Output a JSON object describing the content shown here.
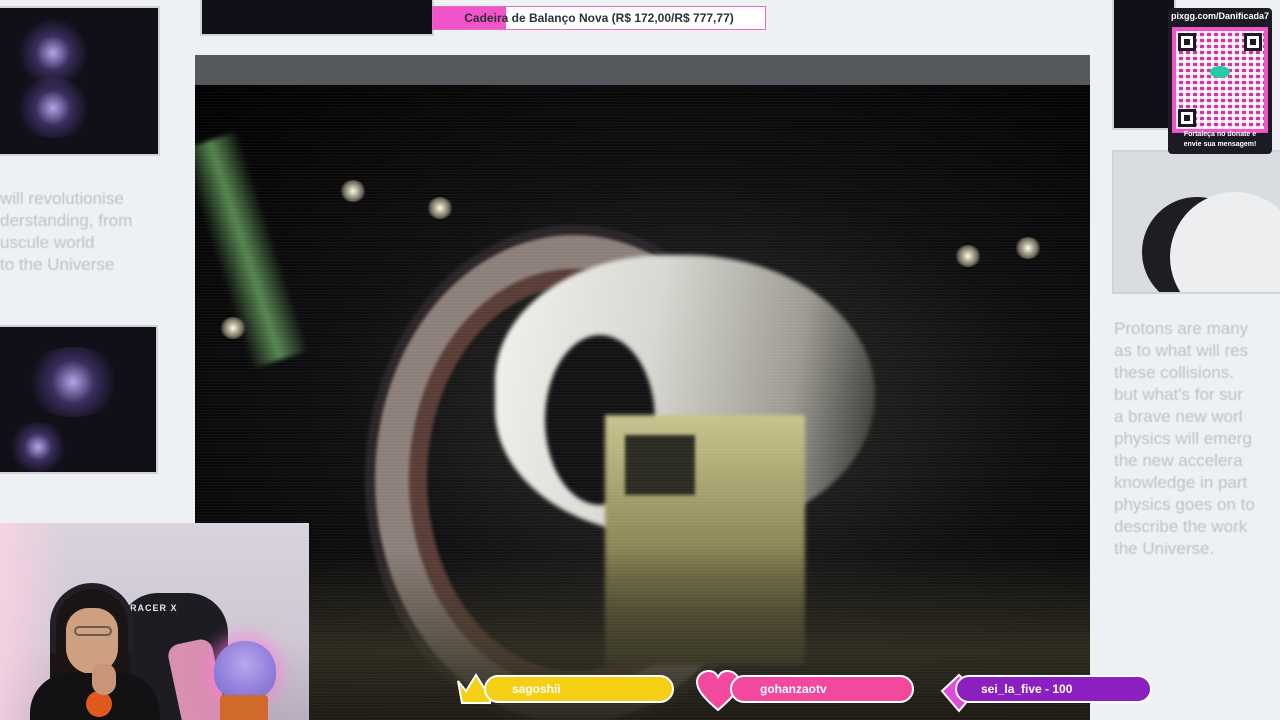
{
  "donation_goal": {
    "label": "Cadeira de Balanço Nova (R$ 172,00/R$ 777,77)",
    "progress_fraction": 0.221,
    "fill_color": "#f154c8"
  },
  "qr_widget": {
    "url": "pixgg.com/Danificada7",
    "caption": "Fortaleça no donate e\nenvie sua mensagem!",
    "accent_color": "#f154c8"
  },
  "background_text": {
    "left": "will revolutionise\nderstanding, from\nuscule world\nto the Universe",
    "right": "Protons are many\nas to what will res\nthese collisions.\nbut what's for sur\na brave new worl\nphysics will emerg\nthe new accelera\nknowledge in part\nphysics goes on to\ndescribe the work\nthe Universe."
  },
  "webcam": {
    "chair_brand": "RACER X"
  },
  "alerts": [
    {
      "name": "sagoshii",
      "icon": "crown-icon",
      "color": "#f4cf16"
    },
    {
      "name": "gohanzaotv",
      "icon": "heart-icon",
      "color": "#f2489e"
    },
    {
      "name": "sei_la_five - 100",
      "icon": "diamond-icon",
      "color": "#8b1fc0"
    }
  ]
}
